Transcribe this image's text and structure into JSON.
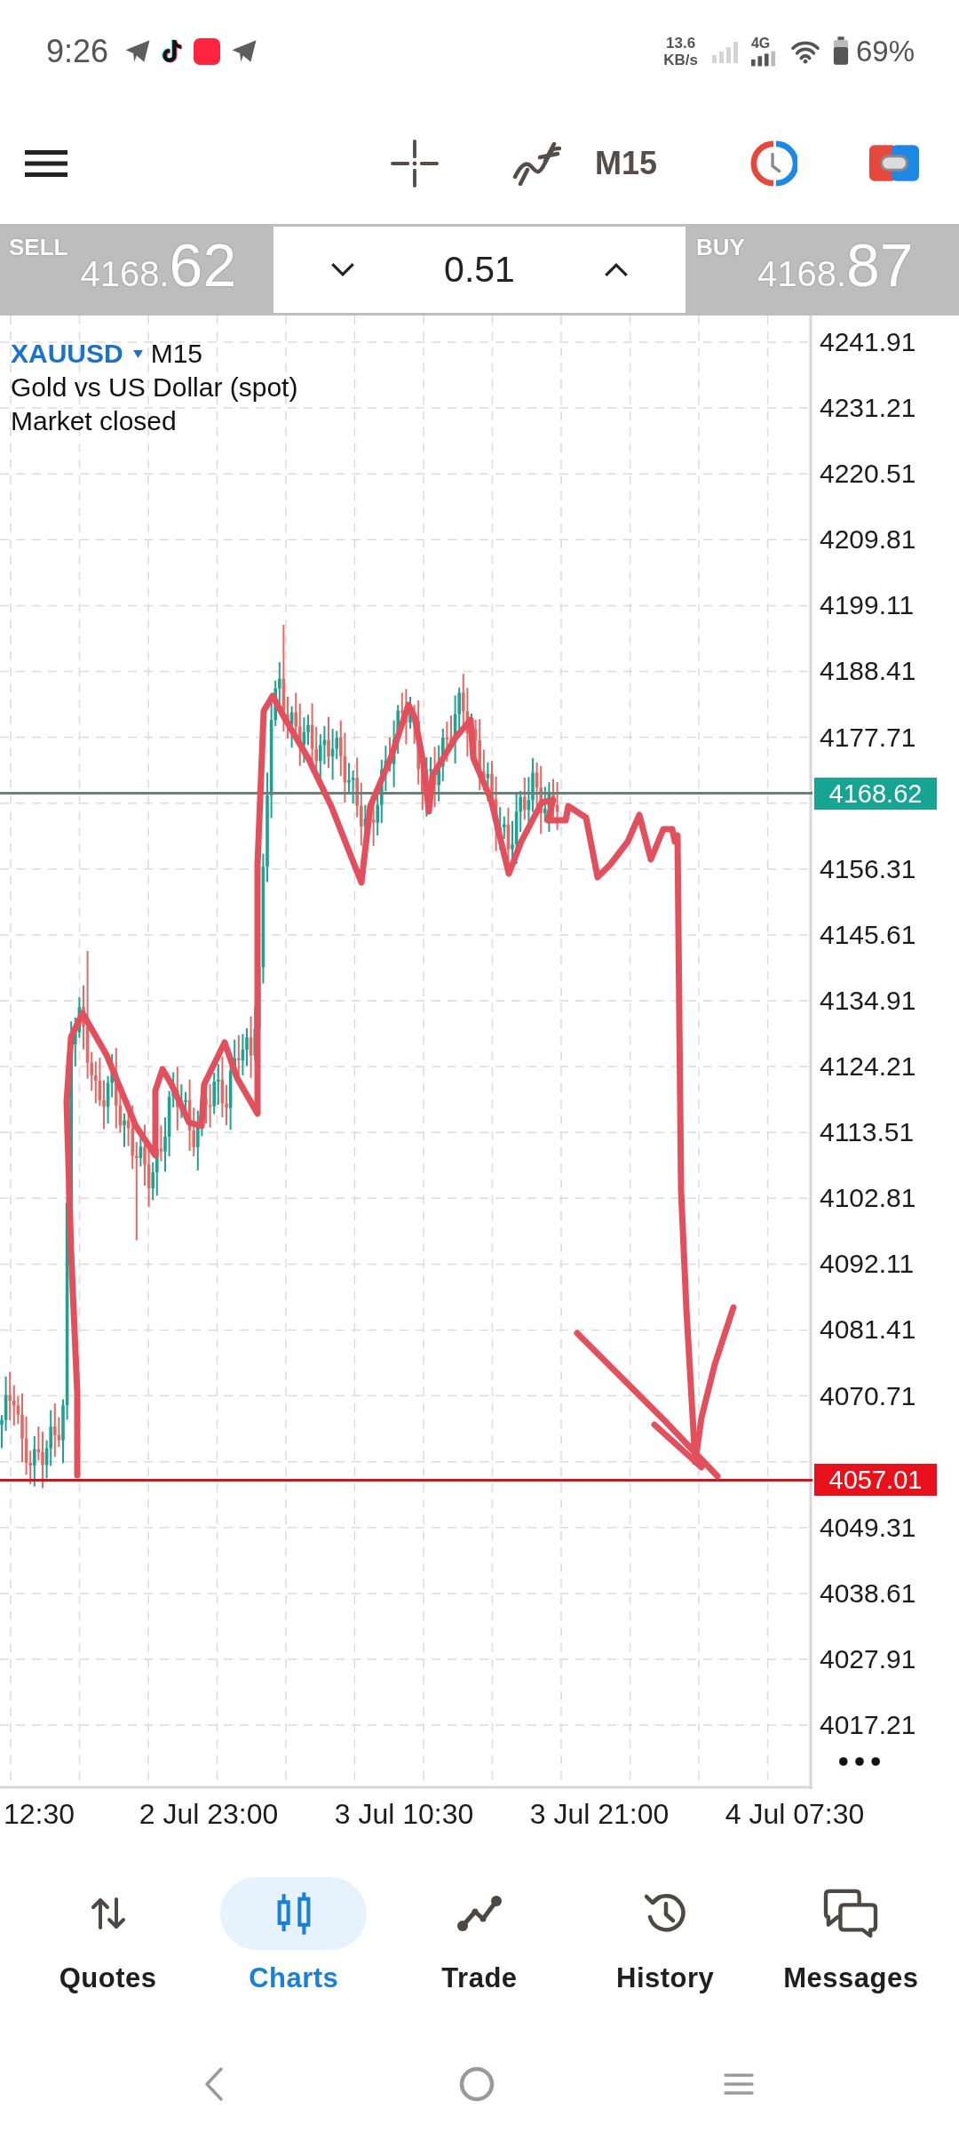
{
  "status_bar": {
    "time": "9:26",
    "net_speed": "13.6",
    "net_speed_unit": "KB/s",
    "network_type": "4G",
    "battery": "69%"
  },
  "toolbar": {
    "timeframe": "M15"
  },
  "trade_panel": {
    "sell": {
      "label": "SELL",
      "price": "4168.",
      "pips": "62"
    },
    "volume": "0.51",
    "buy": {
      "label": "BUY",
      "price": "4168.",
      "pips": "87"
    }
  },
  "chart": {
    "symbol": "XAUUSD",
    "timeframe": "M15",
    "description": "Gold vs US Dollar (spot)",
    "status": "Market closed",
    "price_axis": [
      "4241.91",
      "4231.21",
      "4220.51",
      "4209.81",
      "4199.11",
      "4188.41",
      "4177.71",
      "4156.31",
      "4145.61",
      "4134.91",
      "4124.21",
      "4113.51",
      "4102.81",
      "4092.11",
      "4081.41",
      "4070.71",
      "4049.31",
      "4038.61",
      "4027.91",
      "4017.21"
    ],
    "time_axis": [
      "12:30",
      "2 Jul 23:00",
      "3 Jul 10:30",
      "3 Jul 21:00",
      "4 Jul 07:30"
    ],
    "current_price": "4168.62",
    "marked_price": "4057.01"
  },
  "bottom_nav": [
    {
      "label": "Quotes",
      "selected": false
    },
    {
      "label": "Charts",
      "selected": true
    },
    {
      "label": "Trade",
      "selected": false
    },
    {
      "label": "History",
      "selected": false
    },
    {
      "label": "Messages",
      "selected": false
    }
  ]
}
